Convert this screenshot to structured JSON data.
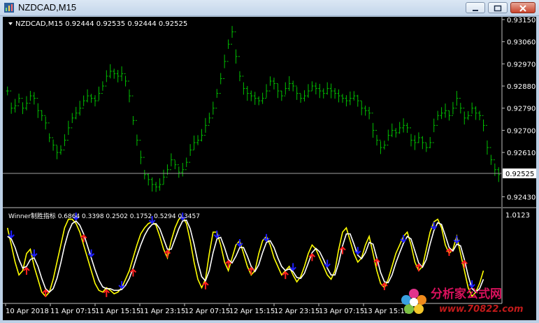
{
  "window": {
    "title": "NZDCAD,M15",
    "controls": {
      "minimize": "minimize",
      "maximize": "maximize",
      "close": "close"
    }
  },
  "main_chart": {
    "header": "NZDCAD,M15  0.92444 0.92535 0.92444 0.92525",
    "y_ticks": [
      "0.93150",
      "0.93060",
      "0.92970",
      "0.92880",
      "0.92790",
      "0.92700",
      "0.92610",
      "0.92430"
    ],
    "current_price": "0.92525",
    "bar_color": "#00c000"
  },
  "indicator": {
    "header": "Winner制胜指标 0.6864 0.3398 0.2502 0.1752 0.5294 0.3457",
    "y_top_label": "1.0123",
    "fast_color": "#ffff00",
    "slow_color": "#ffffff",
    "buy_color": "#ff2020",
    "sell_color": "#2020ff"
  },
  "x_ticks": [
    "10 Apr 2018",
    "11 Apr 07:15",
    "11 Apr 15:15",
    "11 Apr 23:15",
    "12 Apr 07:15",
    "12 Apr 15:15",
    "12 Apr 23:15",
    "13 Apr 07:15",
    "13 Apr 15:15"
  ],
  "watermark": {
    "line1": "分析家公式网",
    "line2": "www.70822.com"
  },
  "chart_data": {
    "type": "bar",
    "series": [
      {
        "name": "NZDCAD,M15",
        "values": [
          0.9286,
          0.9279,
          0.928,
          0.9283,
          0.9279,
          0.9281,
          0.9284,
          0.9283,
          0.9278,
          0.9276,
          0.9273,
          0.9267,
          0.9264,
          0.9261,
          0.9262,
          0.9266,
          0.9271,
          0.9275,
          0.9277,
          0.9279,
          0.9282,
          0.9284,
          0.9283,
          0.9282,
          0.9285,
          0.9288,
          0.9292,
          0.9294,
          0.9293,
          0.9292,
          0.9293,
          0.929,
          0.9284,
          0.9274,
          0.9266,
          0.9259,
          0.9252,
          0.925,
          0.9248,
          0.9247,
          0.9248,
          0.9251,
          0.9254,
          0.9258,
          0.9256,
          0.9253,
          0.9254,
          0.9257,
          0.9262,
          0.9265,
          0.9266,
          0.9268,
          0.9272,
          0.9275,
          0.9279,
          0.9285,
          0.9291,
          0.9298,
          0.9305,
          0.931,
          0.93,
          0.9292,
          0.9287,
          0.9285,
          0.9284,
          0.9283,
          0.9282,
          0.9283,
          0.9286,
          0.929,
          0.9289,
          0.9286,
          0.9284,
          0.9287,
          0.9289,
          0.9288,
          0.9285,
          0.9283,
          0.9284,
          0.9286,
          0.9288,
          0.9287,
          0.9286,
          0.9285,
          0.9287,
          0.9286,
          0.9285,
          0.9284,
          0.9283,
          0.9282,
          0.9283,
          0.9284,
          0.9282,
          0.9279,
          0.9278,
          0.9277,
          0.927,
          0.9266,
          0.9263,
          0.9264,
          0.9268,
          0.927,
          0.9269,
          0.9271,
          0.9272,
          0.9271,
          0.9266,
          0.9265,
          0.9267,
          0.9265,
          0.9263,
          0.9265,
          0.9272,
          0.9276,
          0.9277,
          0.9278,
          0.9276,
          0.9279,
          0.9283,
          0.9279,
          0.9275,
          0.9276,
          0.9279,
          0.9277,
          0.9276,
          0.9272,
          0.9263,
          0.9258,
          0.9254,
          0.9252
        ]
      }
    ],
    "indicator_series": [
      {
        "name": "fast",
        "values": [
          0.85,
          0.65,
          0.45,
          0.3,
          0.35,
          0.55,
          0.6,
          0.4,
          0.25,
          0.1,
          0.05,
          0.1,
          0.25,
          0.45,
          0.65,
          0.85,
          0.95,
          0.95,
          0.9,
          0.8,
          0.65,
          0.5,
          0.35,
          0.2,
          0.12,
          0.1,
          0.15,
          0.12,
          0.08,
          0.1,
          0.15,
          0.25,
          0.35,
          0.5,
          0.65,
          0.78,
          0.85,
          0.9,
          0.92,
          0.88,
          0.75,
          0.6,
          0.5,
          0.7,
          0.85,
          0.95,
          0.98,
          0.9,
          0.7,
          0.45,
          0.25,
          0.15,
          0.25,
          0.55,
          0.8,
          0.8,
          0.65,
          0.45,
          0.35,
          0.5,
          0.65,
          0.7,
          0.55,
          0.4,
          0.3,
          0.35,
          0.55,
          0.7,
          0.75,
          0.65,
          0.5,
          0.4,
          0.3,
          0.35,
          0.4,
          0.3,
          0.22,
          0.28,
          0.4,
          0.55,
          0.65,
          0.6,
          0.5,
          0.4,
          0.3,
          0.25,
          0.35,
          0.6,
          0.8,
          0.85,
          0.7,
          0.55,
          0.45,
          0.5,
          0.65,
          0.75,
          0.55,
          0.35,
          0.2,
          0.15,
          0.25,
          0.4,
          0.55,
          0.65,
          0.75,
          0.8,
          0.65,
          0.45,
          0.35,
          0.4,
          0.6,
          0.8,
          0.92,
          0.95,
          0.85,
          0.65,
          0.55,
          0.6,
          0.75,
          0.55,
          0.35,
          0.15,
          0.05,
          0.1,
          0.2,
          0.35
        ]
      },
      {
        "name": "slow",
        "values": [
          0.75,
          0.72,
          0.62,
          0.48,
          0.38,
          0.4,
          0.48,
          0.5,
          0.4,
          0.26,
          0.14,
          0.1,
          0.14,
          0.26,
          0.44,
          0.64,
          0.8,
          0.9,
          0.93,
          0.88,
          0.78,
          0.64,
          0.5,
          0.36,
          0.24,
          0.16,
          0.14,
          0.14,
          0.12,
          0.12,
          0.13,
          0.18,
          0.26,
          0.38,
          0.52,
          0.65,
          0.76,
          0.84,
          0.89,
          0.9,
          0.84,
          0.72,
          0.6,
          0.6,
          0.72,
          0.84,
          0.93,
          0.94,
          0.84,
          0.66,
          0.45,
          0.28,
          0.23,
          0.35,
          0.56,
          0.72,
          0.74,
          0.62,
          0.48,
          0.44,
          0.52,
          0.62,
          0.62,
          0.52,
          0.4,
          0.34,
          0.42,
          0.56,
          0.68,
          0.7,
          0.62,
          0.5,
          0.4,
          0.35,
          0.37,
          0.34,
          0.27,
          0.26,
          0.32,
          0.44,
          0.56,
          0.61,
          0.57,
          0.48,
          0.38,
          0.3,
          0.3,
          0.44,
          0.64,
          0.78,
          0.78,
          0.66,
          0.53,
          0.49,
          0.56,
          0.68,
          0.66,
          0.5,
          0.33,
          0.22,
          0.21,
          0.3,
          0.44,
          0.56,
          0.67,
          0.75,
          0.72,
          0.58,
          0.44,
          0.39,
          0.48,
          0.66,
          0.82,
          0.91,
          0.89,
          0.76,
          0.62,
          0.58,
          0.66,
          0.64,
          0.48,
          0.29,
          0.14,
          0.1,
          0.14,
          0.25
        ]
      }
    ],
    "signals": [
      {
        "i": 1,
        "dir": "sell"
      },
      {
        "i": 5,
        "dir": "buy"
      },
      {
        "i": 7,
        "dir": "sell"
      },
      {
        "i": 10,
        "dir": "buy"
      },
      {
        "i": 18,
        "dir": "sell"
      },
      {
        "i": 20,
        "dir": "buy"
      },
      {
        "i": 22,
        "dir": "sell"
      },
      {
        "i": 26,
        "dir": "buy"
      },
      {
        "i": 30,
        "dir": "sell"
      },
      {
        "i": 33,
        "dir": "buy"
      },
      {
        "i": 38,
        "dir": "sell"
      },
      {
        "i": 42,
        "dir": "buy"
      },
      {
        "i": 46,
        "dir": "sell"
      },
      {
        "i": 52,
        "dir": "buy"
      },
      {
        "i": 55,
        "dir": "sell"
      },
      {
        "i": 58,
        "dir": "buy"
      },
      {
        "i": 61,
        "dir": "sell"
      },
      {
        "i": 64,
        "dir": "buy"
      },
      {
        "i": 68,
        "dir": "sell"
      },
      {
        "i": 73,
        "dir": "buy"
      },
      {
        "i": 75,
        "dir": "sell"
      },
      {
        "i": 80,
        "dir": "buy"
      },
      {
        "i": 84,
        "dir": "sell"
      },
      {
        "i": 88,
        "dir": "buy"
      },
      {
        "i": 92,
        "dir": "sell"
      },
      {
        "i": 97,
        "dir": "buy"
      },
      {
        "i": 99,
        "dir": "buy"
      },
      {
        "i": 104,
        "dir": "sell"
      },
      {
        "i": 108,
        "dir": "buy"
      },
      {
        "i": 112,
        "dir": "sell"
      },
      {
        "i": 116,
        "dir": "buy"
      },
      {
        "i": 118,
        "dir": "sell"
      },
      {
        "i": 120,
        "dir": "buy"
      },
      {
        "i": 122,
        "dir": "sell"
      }
    ],
    "ylim": [
      0.924,
      0.9315
    ],
    "indicator_ylim": [
      0,
      1.0123
    ],
    "grid": false
  }
}
